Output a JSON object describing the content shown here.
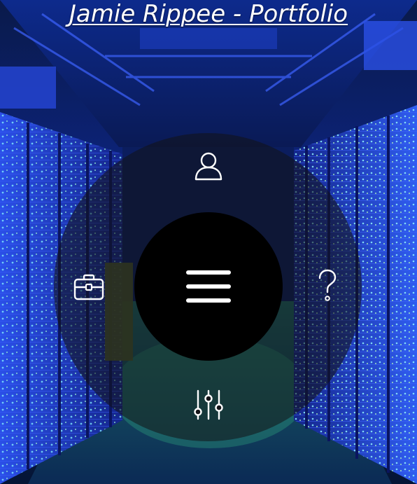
{
  "header": {
    "title": "Jamie Rippee - Portfolio"
  },
  "background": {
    "subject": "data-center-server-aisle",
    "tint": "#1a3ad8",
    "accent_led": "#35e0ff",
    "floor_glow": "#2fd089"
  },
  "radial_menu": {
    "ring_color": "#141418",
    "center_color": "#000000",
    "icon_color": "#ffffff",
    "center_icon": "hamburger-menu-icon",
    "items": [
      {
        "id": "about",
        "icon": "user-icon"
      },
      {
        "id": "portfolio",
        "icon": "briefcase-icon"
      },
      {
        "id": "help",
        "icon": "question-mark-icon"
      },
      {
        "id": "settings",
        "icon": "sliders-icon"
      }
    ]
  }
}
